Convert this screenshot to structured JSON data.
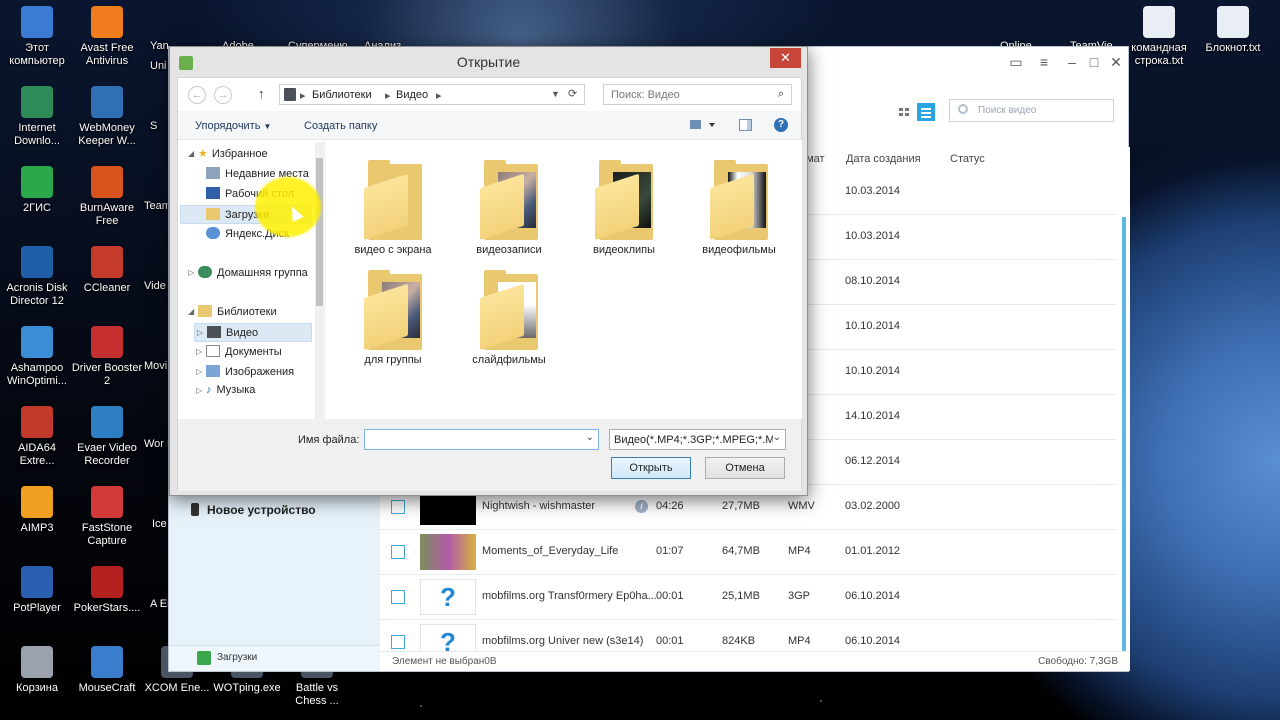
{
  "desktop": {
    "icons": [
      {
        "label": "Этот компьютер",
        "icon": "this-pc-icon",
        "color": "#3b7bd4"
      },
      {
        "label": "Avast Free Antivirus",
        "icon": "avast-icon",
        "color": "#f07c1e"
      },
      {
        "label": "Internet Downlo...",
        "icon": "idm-icon",
        "color": "#2e8b57"
      },
      {
        "label": "WebMoney Keeper W...",
        "icon": "webmoney-icon",
        "color": "#2f6fb3"
      },
      {
        "label": "2ГИС",
        "icon": "2gis-icon",
        "color": "#2aa84a"
      },
      {
        "label": "BurnAware Free",
        "icon": "burnaware-icon",
        "color": "#d9531e"
      },
      {
        "label": "Acronis Disk Director 12",
        "icon": "acronis-icon",
        "color": "#1f5fa8"
      },
      {
        "label": "CCleaner",
        "icon": "ccleaner-icon",
        "color": "#c43b2b"
      },
      {
        "label": "Ashampoo WinOptimi...",
        "icon": "ashampoo-icon",
        "color": "#3b8ed6"
      },
      {
        "label": "Driver Booster 2",
        "icon": "driver-booster-icon",
        "color": "#c62f2f"
      },
      {
        "label": "AIDA64 Extre...",
        "icon": "aida64-icon",
        "color": "#c0392b"
      },
      {
        "label": "Evaer Video Recorder",
        "icon": "evaer-icon",
        "color": "#2d7fc1"
      },
      {
        "label": "AIMP3",
        "icon": "aimp-icon",
        "color": "#f0a020"
      },
      {
        "label": "FastStone Capture",
        "icon": "faststone-icon",
        "color": "#d23a3a"
      },
      {
        "label": "PotPlayer",
        "icon": "potplayer-icon",
        "color": "#2a5fb0"
      },
      {
        "label": "PokerStars....",
        "icon": "pokerstars-icon",
        "color": "#b52020"
      },
      {
        "label": "Корзина",
        "icon": "recycle-bin-icon",
        "color": "#9aa3ad"
      },
      {
        "label": "MouseCraft",
        "icon": "mousecraft-icon",
        "color": "#3a7dcc"
      },
      {
        "label": "XCOM Ene...",
        "icon": "xcom-icon",
        "color": "#4a5563"
      },
      {
        "label": "WOTping.exe",
        "icon": "wotping-icon",
        "color": "#4a5563"
      },
      {
        "label": "Battle vs Chess ...",
        "icon": "battle-chess-icon",
        "color": "#4a5563"
      },
      {
        "label": "командная строка.txt",
        "icon": "text-file-icon",
        "color": "#e9eef4"
      },
      {
        "label": "Блокнот.txt",
        "icon": "notepad-icon",
        "color": "#e9eef4"
      }
    ],
    "partial_labels": [
      "Yan",
      "Uni",
      "S",
      "Team",
      "Vide",
      "Movi",
      "Wor Mob",
      "Ice Eb",
      "A Emp",
      "Adobe",
      "Суперменю",
      "Анализ",
      "Online",
      "TeamVie"
    ]
  },
  "app": {
    "search_placeholder": "Поиск видео",
    "columns": {
      "format": "омат",
      "created": "Дата создания",
      "status": "Статус"
    },
    "hidden_rows_dates": [
      "10.03.2014",
      "10.03.2014",
      "08.10.2014",
      "10.10.2014",
      "10.10.2014",
      "14.10.2014",
      "06.12.2014"
    ],
    "rows": [
      {
        "name": "Nightwish - wishmaster",
        "duration": "04:26",
        "size": "27,7MB",
        "format": "WMV",
        "date": "03.02.2000"
      },
      {
        "name": "Moments_of_Everyday_Life",
        "duration": "01:07",
        "size": "64,7MB",
        "format": "MP4",
        "date": "01.01.2012"
      },
      {
        "name": "mobfilms.org Transf0rmery Ep0ha...",
        "duration": "00:01",
        "size": "25,1MB",
        "format": "3GP",
        "date": "06.10.2014"
      },
      {
        "name": "mobfilms.org Univer new (s3e14)",
        "duration": "00:01",
        "size": "824KB",
        "format": "MP4",
        "date": "06.10.2014"
      }
    ],
    "sidebar_device": "Новое устройство",
    "sidebar_downloads": "Загрузки",
    "status_left": "Элемент не выбран0B",
    "status_right": "Свободно: 7,3GB"
  },
  "dialog": {
    "title": "Открытие",
    "close": "✕",
    "address": {
      "root": "Библиотеки",
      "current": "Видео"
    },
    "search_placeholder": "Поиск: Видео",
    "commands": {
      "organize": "Упорядочить",
      "new_folder": "Создать папку"
    },
    "nav": {
      "favorites": "Избранное",
      "recent": "Недавние места",
      "desktop": "Рабочий стол",
      "downloads": "Загрузки",
      "yandex": "Яндекс.Диск",
      "homegroup": "Домашняя группа",
      "libraries": "Библиотеки",
      "video": "Видео",
      "documents": "Документы",
      "images": "Изображения",
      "music": "Музыка"
    },
    "folders": [
      {
        "name": "видео с экрана",
        "thumb": "none"
      },
      {
        "name": "видеозаписи",
        "thumb": "photo"
      },
      {
        "name": "видеоклипы",
        "thumb": "dark"
      },
      {
        "name": "видеофильмы",
        "thumb": "film"
      },
      {
        "name": "для группы",
        "thumb": "photo"
      },
      {
        "name": "слайдфильмы",
        "thumb": "gray"
      }
    ],
    "filename_label": "Имя файла:",
    "filename_value": "",
    "filetype": "Видео(*.MP4;*.3GP;*.MPEG;*.M",
    "open_button": "Открыть",
    "cancel_button": "Отмена"
  }
}
